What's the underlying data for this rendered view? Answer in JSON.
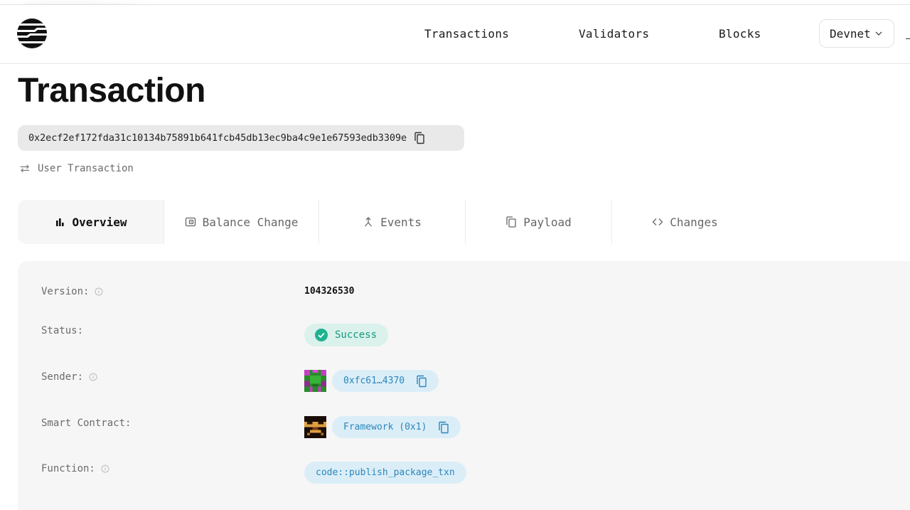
{
  "header": {
    "nav": [
      "Transactions",
      "Validators",
      "Blocks"
    ],
    "network": "Devnet"
  },
  "page": {
    "title": "Transaction",
    "hash": "0x2ecf2ef172fda31c10134b75891b641fcb45db13ec9ba4c9e1e67593edb3309e",
    "tx_type": "User Transaction"
  },
  "tabs": [
    "Overview",
    "Balance Change",
    "Events",
    "Payload",
    "Changes"
  ],
  "overview": {
    "version_label": "Version:",
    "version": "104326530",
    "status_label": "Status:",
    "status": "Success",
    "sender_label": "Sender:",
    "sender": "0xfc61…4370",
    "contract_label": "Smart Contract:",
    "contract": "Framework (0x1)",
    "function_label": "Function:",
    "function": "code::publish_package_txn"
  },
  "colors": {
    "success_bg": "#daf1ec",
    "success_text": "#159a7d",
    "chip_bg": "#dbeef8",
    "chip_text": "#2b86b9"
  }
}
